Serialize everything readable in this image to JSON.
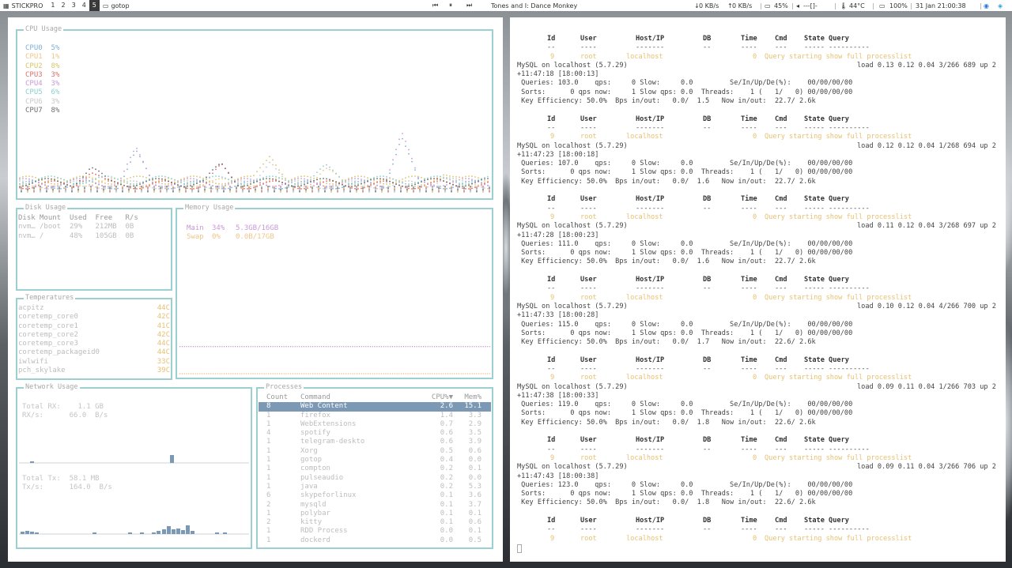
{
  "topbar": {
    "app_label": "STICKPRO",
    "workspaces": [
      "1",
      "2",
      "3",
      "4",
      "5"
    ],
    "active_workspace": "5",
    "window_title": "gotop",
    "media_title": "Tones and I: Dance Monkey",
    "net_down": "0 KB/s",
    "net_up": "0 KB/s",
    "brightness": "45%",
    "volume": "---[]-",
    "temp": "44°C",
    "battery": "100%",
    "datetime": "31 Jan 21:00:38"
  },
  "gotop": {
    "cpu": {
      "title": "CPU Usage",
      "cores": [
        {
          "name": "CPU0",
          "value": "5%",
          "color": "#7fb0d6"
        },
        {
          "name": "CPU1",
          "value": "1%",
          "color": "#f0c58a"
        },
        {
          "name": "CPU2",
          "value": "8%",
          "color": "#d7c56a"
        },
        {
          "name": "CPU3",
          "value": "3%",
          "color": "#e06c6c"
        },
        {
          "name": "CPU4",
          "value": "3%",
          "color": "#c79ad6"
        },
        {
          "name": "CPU5",
          "value": "6%",
          "color": "#8bcfcf"
        },
        {
          "name": "CPU6",
          "value": "3%",
          "color": "#c8c8c8"
        },
        {
          "name": "CPU7",
          "value": "8%",
          "color": "#6e6e6e"
        }
      ]
    },
    "disk": {
      "title": "Disk Usage",
      "headers": [
        "Disk",
        "Mount",
        "Used",
        "Free",
        "R/s"
      ],
      "rows": [
        [
          "nvm…",
          "/boot",
          "29%",
          "212MB",
          "0B"
        ],
        [
          "nvm…",
          "/",
          "48%",
          "105GB",
          "0B"
        ]
      ]
    },
    "memory": {
      "title": "Memory Usage",
      "rows": [
        {
          "name": "Main",
          "pct": "34%",
          "amount": "5.3GB/16GB",
          "level": 0.34
        },
        {
          "name": "Swap",
          "pct": "0%",
          "amount": "0.0B/17GB",
          "level": 0.0
        }
      ]
    },
    "temps": {
      "title": "Temperatures",
      "rows": [
        [
          "acpitz",
          "44C"
        ],
        [
          "coretemp_core0",
          "42C"
        ],
        [
          "coretemp_core1",
          "41C"
        ],
        [
          "coretemp_core2",
          "42C"
        ],
        [
          "coretemp_core3",
          "44C"
        ],
        [
          "coretemp_packageid0",
          "44C"
        ],
        [
          "iwlwifi",
          "33C"
        ],
        [
          "pch_skylake",
          "39C"
        ]
      ]
    },
    "network": {
      "title": "Network Usage",
      "rx_total_label": "Total RX:",
      "rx_total": "1.1 GB",
      "rx_rate_label": "RX/s:",
      "rx_rate": "66.0  B/s",
      "tx_total_label": "Total Tx:",
      "tx_total": "58.1 MB",
      "tx_rate_label": "Tx/s:",
      "tx_rate": "164.0  B/s"
    },
    "processes": {
      "title": "Processes",
      "headers": [
        "Count",
        "Command",
        "CPU%▼",
        "Mem%"
      ],
      "rows": [
        [
          "8",
          "Web Content",
          "2.6",
          "15.1"
        ],
        [
          "1",
          "firefox",
          "1.4",
          "3.3"
        ],
        [
          "1",
          "WebExtensions",
          "0.7",
          "2.9"
        ],
        [
          "4",
          "spotify",
          "0.6",
          "3.5"
        ],
        [
          "1",
          "telegram-deskto",
          "0.6",
          "3.9"
        ],
        [
          "1",
          "Xorg",
          "0.5",
          "0.6"
        ],
        [
          "1",
          "gotop",
          "0.4",
          "0.0"
        ],
        [
          "1",
          "compton",
          "0.2",
          "0.1"
        ],
        [
          "1",
          "pulseaudio",
          "0.2",
          "0.0"
        ],
        [
          "1",
          "java",
          "0.2",
          "5.3"
        ],
        [
          "6",
          "skypeforlinux",
          "0.1",
          "3.6"
        ],
        [
          "2",
          "mysqld",
          "0.1",
          "3.7"
        ],
        [
          "1",
          "polybar",
          "0.1",
          "0.1"
        ],
        [
          "2",
          "kitty",
          "0.1",
          "0.6"
        ],
        [
          "1",
          "RDD Process",
          "0.0",
          "0.1"
        ],
        [
          "1",
          "dockerd",
          "0.0",
          "0.5"
        ]
      ]
    }
  },
  "mytop": {
    "col_headers": {
      "id": "Id",
      "user": "User",
      "host": "Host/IP",
      "db": "DB",
      "time": "Time",
      "cmd": "Cmd",
      "state": "State Query"
    },
    "col_dashes": {
      "id": "--",
      "user": "----",
      "host": "-------",
      "db": "--",
      "time": "----",
      "cmd": "---",
      "state": "----- ----------"
    },
    "proc_row": {
      "id": "9",
      "user": "root",
      "host": "localhost",
      "time": "0",
      "info": "Query starting show full processlist"
    },
    "blocks": [
      {
        "status": "MySQL on localhost (5.7.29)",
        "load": "load 0.13 0.12 0.04 3/266 689 up 2",
        "uptime": "+11:47:18 [18:00:13]",
        "q1": " Queries: 103.0    qps:     0 Slow:     0.0         Se/In/Up/De(%):    00/00/00/00",
        "q2": " Sorts:      0 qps now:     1 Slow qps: 0.0  Threads:    1 (   1/   0) 00/00/00/00",
        "q3": " Key Efficiency: 50.0%  Bps in/out:   0.0/  1.5   Now in/out:  22.7/ 2.6k"
      },
      {
        "status": "MySQL on localhost (5.7.29)",
        "load": "load 0.12 0.12 0.04 1/268 694 up 2",
        "uptime": "+11:47:23 [18:00:18]",
        "q1": " Queries: 107.0    qps:     0 Slow:     0.0         Se/In/Up/De(%):    00/00/00/00",
        "q2": " Sorts:      0 qps now:     1 Slow qps: 0.0  Threads:    1 (   1/   0) 00/00/00/00",
        "q3": " Key Efficiency: 50.0%  Bps in/out:   0.0/  1.6   Now in/out:  22.7/ 2.6k"
      },
      {
        "status": "MySQL on localhost (5.7.29)",
        "load": "load 0.11 0.12 0.04 3/268 697 up 2",
        "uptime": "+11:47:28 [18:00:23]",
        "q1": " Queries: 111.0    qps:     0 Slow:     0.0         Se/In/Up/De(%):    00/00/00/00",
        "q2": " Sorts:      0 qps now:     1 Slow qps: 0.0  Threads:    1 (   1/   0) 00/00/00/00",
        "q3": " Key Efficiency: 50.0%  Bps in/out:   0.0/  1.6   Now in/out:  22.7/ 2.6k"
      },
      {
        "status": "MySQL on localhost (5.7.29)",
        "load": "load 0.10 0.12 0.04 4/266 700 up 2",
        "uptime": "+11:47:33 [18:00:28]",
        "q1": " Queries: 115.0    qps:     0 Slow:     0.0         Se/In/Up/De(%):    00/00/00/00",
        "q2": " Sorts:      0 qps now:     1 Slow qps: 0.0  Threads:    1 (   1/   0) 00/00/00/00",
        "q3": " Key Efficiency: 50.0%  Bps in/out:   0.0/  1.7   Now in/out:  22.6/ 2.6k"
      },
      {
        "status": "MySQL on localhost (5.7.29)",
        "load": "load 0.09 0.11 0.04 1/266 703 up 2",
        "uptime": "+11:47:38 [18:00:33]",
        "q1": " Queries: 119.0    qps:     0 Slow:     0.0         Se/In/Up/De(%):    00/00/00/00",
        "q2": " Sorts:      0 qps now:     1 Slow qps: 0.0  Threads:    1 (   1/   0) 00/00/00/00",
        "q3": " Key Efficiency: 50.0%  Bps in/out:   0.0/  1.8   Now in/out:  22.6/ 2.6k"
      },
      {
        "status": "MySQL on localhost (5.7.29)",
        "load": "load 0.09 0.11 0.04 3/266 706 up 2",
        "uptime": "+11:47:43 [18:00:38]",
        "q1": " Queries: 123.0    qps:     0 Slow:     0.0         Se/In/Up/De(%):    00/00/00/00",
        "q2": " Sorts:      0 qps now:     1 Slow qps: 0.0  Threads:    1 (   1/   0) 00/00/00/00",
        "q3": " Key Efficiency: 50.0%  Bps in/out:   0.0/  1.8   Now in/out:  22.6/ 2.6k"
      }
    ]
  }
}
